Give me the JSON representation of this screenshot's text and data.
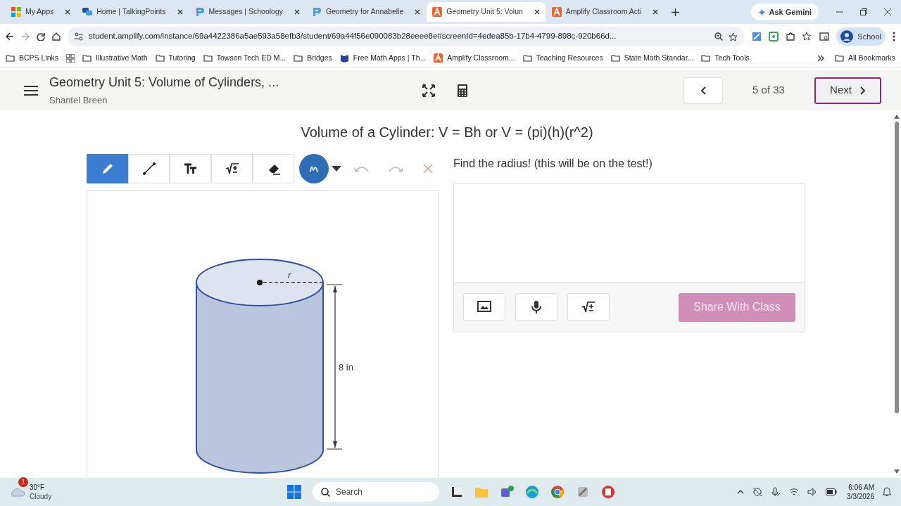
{
  "browser": {
    "tabs": [
      {
        "label": "My Apps",
        "selected": false,
        "kind": "microsoft"
      },
      {
        "label": "Home | TalkingPoints",
        "selected": false,
        "kind": "chat"
      },
      {
        "label": "Messages | Schoology",
        "selected": false,
        "kind": "schoology"
      },
      {
        "label": "Geometry for Annabelle",
        "selected": false,
        "kind": "schoology"
      },
      {
        "label": "Geometry Unit 5: Volun",
        "selected": true,
        "kind": "amplify"
      },
      {
        "label": "Amplify Classroom Acti",
        "selected": false,
        "kind": "amplify"
      }
    ],
    "ask_gemini": "Ask Gemini",
    "url": "student.amplify.com/instance/69a4422386a5ae593a58efb3/student/69a44f56e090083b28eeee8e#screenId=4edea85b-17b4-4799-898c-920b66d...",
    "profile": "School",
    "bookmarks": [
      {
        "label": "BCPS Links",
        "kind": "folder"
      },
      {
        "label": "Illustrative Math",
        "kind": "folder"
      },
      {
        "label": "Tutoring",
        "kind": "folder"
      },
      {
        "label": "Towson Tech ED M...",
        "kind": "folder"
      },
      {
        "label": "Bridges",
        "kind": "folder"
      },
      {
        "label": "Free Math Apps | Th...",
        "kind": "site"
      },
      {
        "label": "Amplify Classroom...",
        "kind": "amplify"
      },
      {
        "label": "Teaching Resources",
        "kind": "folder"
      },
      {
        "label": "State Math Standar...",
        "kind": "folder"
      },
      {
        "label": "Tech Tools",
        "kind": "folder"
      }
    ],
    "all_bookmarks": "All Bookmarks"
  },
  "app_header": {
    "title": "Geometry Unit 5: Volume of Cylinders, ...",
    "subtitle": "Shantel Breen",
    "page": "5 of 33",
    "next": "Next"
  },
  "slide": {
    "heading": "Volume of a Cylinder: V = Bh or V = (pi)(h)(r^2)",
    "tools": [
      {
        "kind": "pen",
        "selected": true
      },
      {
        "kind": "line",
        "selected": false
      },
      {
        "kind": "text",
        "selected": false
      },
      {
        "kind": "math",
        "selected": false
      },
      {
        "kind": "eraser",
        "selected": false
      }
    ],
    "figure": {
      "radius_label": "r",
      "height_label": "8 in"
    },
    "prompt": "Find the radius! (this will be on the test!)",
    "share_button": {
      "label": "Share With Class",
      "disabled": true
    }
  },
  "taskbar": {
    "badge": "1",
    "temperature": "30°F",
    "weather": "Cloudy",
    "search": "Search",
    "time": "6:06 AM",
    "date": "3/3/2026"
  }
}
